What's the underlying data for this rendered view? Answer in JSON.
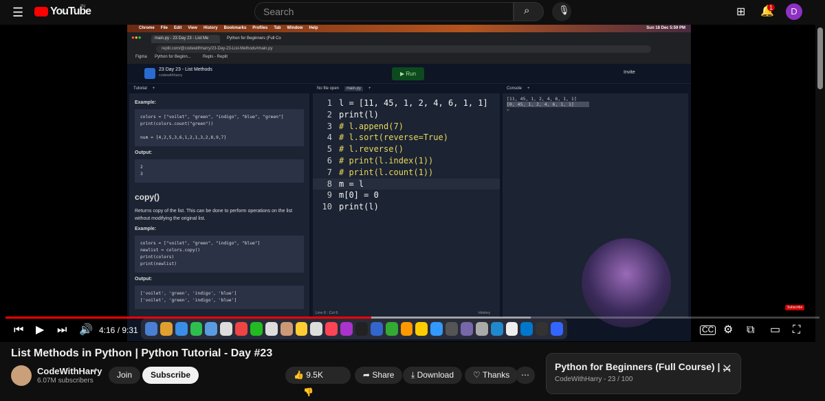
{
  "youtube": {
    "logo": "YouTube",
    "region": "IN",
    "search_placeholder": "Search",
    "notif_count": "1",
    "avatar_letter": "D"
  },
  "mac": {
    "menu": [
      "Chrome",
      "File",
      "Edit",
      "View",
      "History",
      "Bookmarks",
      "Profiles",
      "Tab",
      "Window",
      "Help"
    ],
    "clock": "Sun 18 Dec 5:59 PM"
  },
  "browser": {
    "tabs": [
      "main.py - 23 Day 23 - List Me",
      "Python for Beginners (Full Co"
    ],
    "url": "replit.com/@codewithharry/23-Day-23-List-Methods#main.py",
    "bookmarks": [
      "Figma",
      "Python for Beginn...",
      "Repls - Replit"
    ]
  },
  "replit": {
    "repl_name": "23 Day 23 - List Methods",
    "owner": "codewithharry",
    "run": "Run",
    "invite": "Invite",
    "tutorial": {
      "tab": "Tutorial",
      "example1": "Example:",
      "code1": "colors = [\"voilet\", \"green\", \"indigo\", \"blue\", \"green\"]\nprint(colors.count(\"green\"))\n\nnum = [4,2,5,3,6,1,2,1,3,2,8,9,7]",
      "output1": "Output:",
      "out1": "2\n3",
      "heading": "copy()",
      "desc": "Returns copy of the list. This can be done to perform operations on the list without modifying the original list.",
      "example2": "Example:",
      "code2": "colors = [\"voilet\", \"green\", \"indigo\", \"blue\"]\nnewlist = colors.copy()\nprint(colors)\nprint(newlist)",
      "output2": "Output:",
      "out2": "['voilet', 'green', 'indigo', 'blue']\n['voilet', 'green', 'indigo', 'blue']"
    },
    "editor": {
      "tabs": [
        "No file open",
        "main.py"
      ],
      "lines": [
        "l = [11, 45, 1, 2, 4, 6, 1, 1]",
        "print(l)",
        "# l.append(7)",
        "# l.sort(reverse=True)",
        "# l.reverse()",
        "# print(l.index(1))",
        "# print(l.count(1))",
        "m = l",
        "m[0] = 0",
        "print(l)"
      ],
      "status": "Line 8 : Col 6",
      "history": "History"
    },
    "console": {
      "tab": "Console",
      "lines": [
        "[11, 45, 1, 2, 4, 6, 1, 1]",
        "[0, 45, 1, 2, 4, 6, 1, 1]",
        ">"
      ]
    }
  },
  "player": {
    "time": "4:16 / 9:31",
    "progress": 0.449,
    "buffered": 0.645,
    "subscribe_watermark": "Subscribe"
  },
  "video": {
    "title": "List Methods in Python | Python Tutorial - Day #23",
    "channel": "CodeWithHarry",
    "subscribers": "6.07M subscribers",
    "join": "Join",
    "subscribe": "Subscribe",
    "likes": "9.5K",
    "share": "Share",
    "download": "Download",
    "thanks": "Thanks"
  },
  "playlist": {
    "title": "Python for Beginners (Full Course) | ...",
    "meta": "CodeWithHarry - 23 / 100"
  }
}
